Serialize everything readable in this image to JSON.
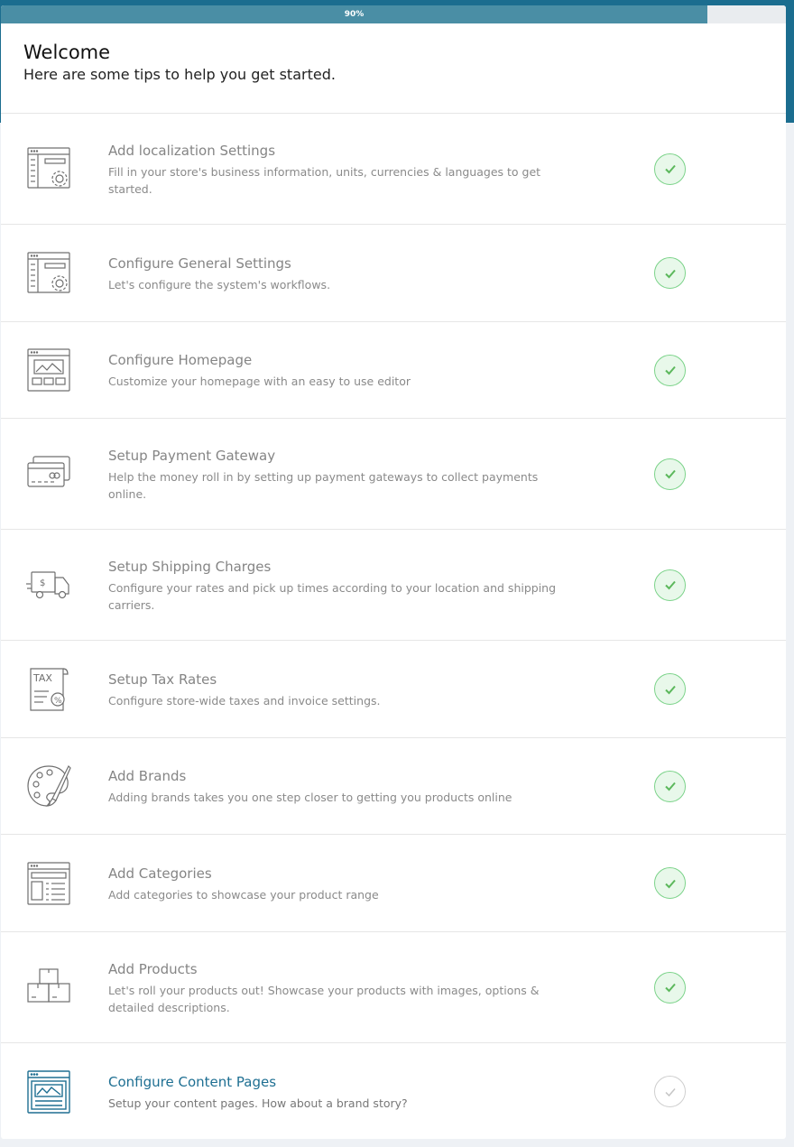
{
  "progress": {
    "label": "90%",
    "value": 0.9
  },
  "welcome": {
    "title": "Welcome",
    "subtitle": "Here are some tips to help you get started."
  },
  "colors": {
    "accent": "#1e6f92",
    "progress": "#4a8ea5",
    "done": "#5cb85c"
  },
  "steps": [
    {
      "title": "Add localization Settings",
      "desc": "Fill in your store's business information, units, currencies & languages to get started.",
      "icon": "localization-settings-icon",
      "status": "done"
    },
    {
      "title": "Configure General Settings",
      "desc": "Let's configure the system's workflows.",
      "icon": "general-settings-icon",
      "status": "done"
    },
    {
      "title": "Configure Homepage",
      "desc": "Customize your homepage with an easy to use editor",
      "icon": "homepage-icon",
      "status": "done"
    },
    {
      "title": "Setup Payment Gateway",
      "desc": "Help the money roll in by setting up payment gateways to collect payments online.",
      "icon": "payment-card-icon",
      "status": "done"
    },
    {
      "title": "Setup Shipping Charges",
      "desc": "Configure your rates and pick up times according to your location and shipping carriers.",
      "icon": "shipping-truck-icon",
      "status": "done"
    },
    {
      "title": "Setup Tax Rates",
      "desc": "Configure store-wide taxes and invoice settings.",
      "icon": "tax-document-icon",
      "status": "done"
    },
    {
      "title": "Add Brands",
      "desc": "Adding brands takes you one step closer to getting you products online",
      "icon": "palette-brush-icon",
      "status": "done"
    },
    {
      "title": "Add Categories",
      "desc": "Add categories to showcase your product range",
      "icon": "categories-icon",
      "status": "done"
    },
    {
      "title": "Add Products",
      "desc": "Let's roll your products out! Showcase your products with images, options & detailed descriptions.",
      "icon": "products-boxes-icon",
      "status": "done"
    },
    {
      "title": "Configure Content Pages",
      "desc": "Setup your content pages. How about a brand story?",
      "icon": "content-pages-icon",
      "status": "pending"
    }
  ]
}
